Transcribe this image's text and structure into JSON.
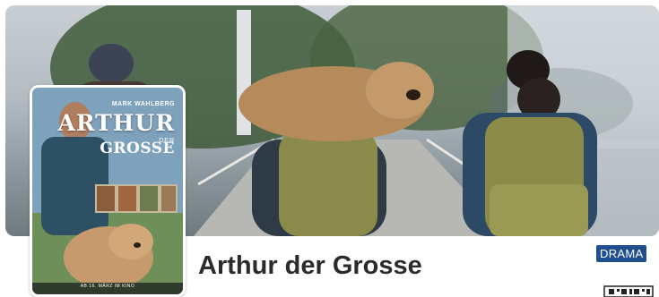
{
  "movie": {
    "title": "Arthur der Grosse",
    "genre": "DRAMA"
  },
  "poster": {
    "actor": "MARK WAHLBERG",
    "title_line_1": "ARTHUR",
    "title_line_2": "DER",
    "title_line_3": "GROSSE",
    "release_note": "AB 16. MÄRZ IM KINO"
  },
  "icons": {
    "qr": "qr-code-icon"
  },
  "colors": {
    "genre_badge": "#1f4f8f",
    "title_text": "#2b2b2b"
  }
}
